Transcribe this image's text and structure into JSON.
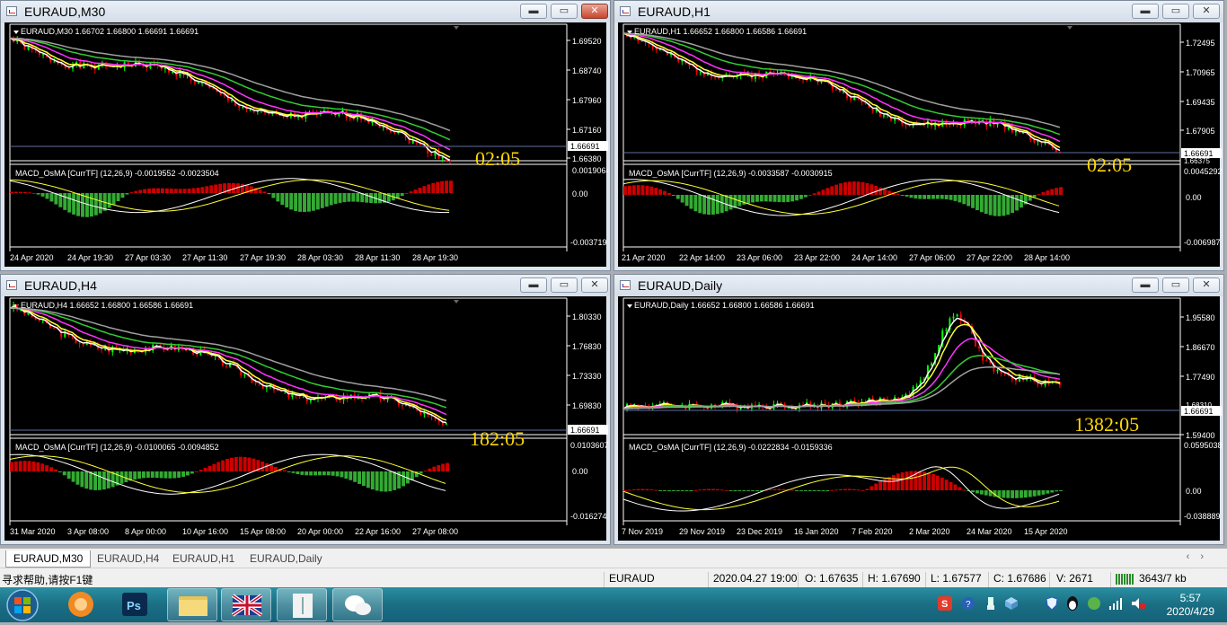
{
  "windows": {
    "m30": {
      "title": "EURAUD,M30",
      "info": "EURAUD,M30  1.66702 1.66800 1.66691 1.66691",
      "prices": [
        "1.69520",
        "1.68740",
        "1.67960",
        "1.67160",
        "1.66380"
      ],
      "price_tag": "1.66691",
      "countdown": "02:05",
      "macd": "MACD_OsMA [CurrTF] (12,26,9) -0.0019552 -0.0023504",
      "macd_top": "0.0019064",
      "macd_zero": "0.00",
      "macd_bottom": "-0.003719",
      "dates": [
        "24 Apr 2020",
        "24 Apr 19:30",
        "27 Apr 03:30",
        "27 Apr 11:30",
        "27 Apr 19:30",
        "28 Apr 03:30",
        "28 Apr 11:30",
        "28 Apr 19:30"
      ]
    },
    "h1": {
      "title": "EURAUD,H1",
      "info": "EURAUD,H1  1.66652 1.66800 1.66586 1.66691",
      "prices": [
        "1.72495",
        "1.70965",
        "1.69435",
        "1.67905"
      ],
      "price_tag": "1.66691",
      "price_tag2": "1.66375",
      "countdown": "02:05",
      "macd": "MACD_OsMA [CurrTF] (12,26,9) -0.0033587 -0.0030915",
      "macd_top": "0.0045292",
      "macd_zero": "0.00",
      "macd_bottom": "-0.006987",
      "dates": [
        "21 Apr 2020",
        "22 Apr 14:00",
        "23 Apr 06:00",
        "23 Apr 22:00",
        "24 Apr 14:00",
        "27 Apr 06:00",
        "27 Apr 22:00",
        "28 Apr 14:00"
      ]
    },
    "h4": {
      "title": "EURAUD,H4",
      "info": "EURAUD,H4  1.66652 1.66800 1.66586 1.66691",
      "prices": [
        "1.80330",
        "1.76830",
        "1.73330",
        "1.69830"
      ],
      "price_tag": "1.66691",
      "countdown": "182:05",
      "macd": "MACD_OsMA [CurrTF] (12,26,9) -0.0100065 -0.0094852",
      "macd_top": "0.0103607",
      "macd_zero": "0.00",
      "macd_bottom": "-0.016274",
      "dates": [
        "31 Mar 2020",
        "3 Apr 08:00",
        "8 Apr 00:00",
        "10 Apr 16:00",
        "15 Apr 08:00",
        "20 Apr 00:00",
        "22 Apr 16:00",
        "27 Apr 08:00"
      ]
    },
    "daily": {
      "title": "EURAUD,Daily",
      "info": "EURAUD,Daily  1.66652 1.66800 1.66586 1.66691",
      "prices": [
        "1.95580",
        "1.86670",
        "1.77490",
        "1.68310",
        "1.59400"
      ],
      "price_tag": "1.66691",
      "countdown": "1382:05",
      "macd": "MACD_OsMA [CurrTF] (12,26,9) -0.0222834 -0.0159336",
      "macd_top": "0.0595038",
      "macd_zero": "0.00",
      "macd_bottom": "-0.038889",
      "dates": [
        "7 Nov 2019",
        "29 Nov 2019",
        "23 Dec 2019",
        "16 Jan 2020",
        "7 Feb 2020",
        "2 Mar 2020",
        "24 Mar 2020",
        "15 Apr 2020"
      ]
    }
  },
  "tabs": [
    "EURAUD,M30",
    "EURAUD,H4",
    "EURAUD,H1",
    "EURAUD,Daily"
  ],
  "status": {
    "help": "寻求帮助,请按F1键",
    "symbol": "EURAUD",
    "datetime": "2020.04.27 19:00",
    "open": "O: 1.67635",
    "high": "H: 1.67690",
    "low": "L: 1.67577",
    "close": "C: 1.67686",
    "volume": "V: 2671",
    "traffic": "3643/7 kb"
  },
  "clock": {
    "time": "5:57",
    "date": "2020/4/29"
  },
  "colors": {
    "bull": "#00ff00",
    "bear": "#ff0000",
    "gold": "#ffd700",
    "ma_white": "#ffffff",
    "ma_yellow": "#ffff33",
    "ma_magenta": "#ff33ff",
    "ma_green": "#33cc33",
    "ma_gray": "#a0a0a0",
    "osma_pos": "#cc0000",
    "osma_neg": "#33aa33"
  },
  "taskbar": {
    "icons": [
      "start-orb-icon",
      "browser-fox-icon",
      "photoshop-icon",
      "file-explorer-icon",
      "uk-flag-trading-icon",
      "document-tool-icon",
      "wechat-icon"
    ]
  }
}
